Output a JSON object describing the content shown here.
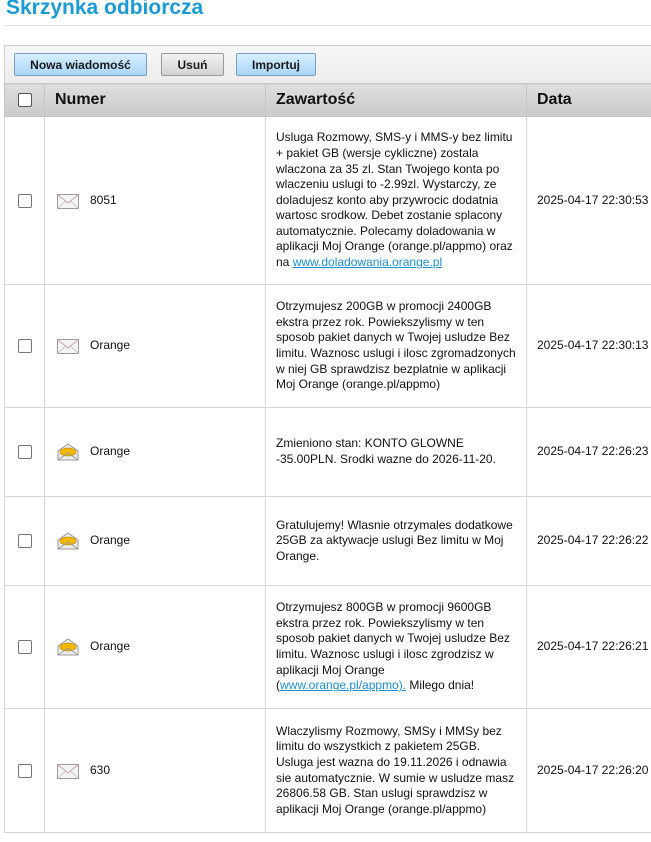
{
  "page": {
    "title": "Skrzynka odbiorcza"
  },
  "toolbar": {
    "new_label": "Nowa wiadomość",
    "delete_label": "Usuń",
    "import_label": "Importuj"
  },
  "table": {
    "headers": {
      "number": "Numer",
      "content": "Zawartość",
      "date": "Data"
    },
    "rows": [
      {
        "icon": "envelope-closed-icon",
        "number": "8051",
        "content": "Usluga Rozmowy, SMS-y i MMS-y bez limitu + pakiet GB (wersje cykliczne) zostala wlaczona za 35 zl. Stan Twojego konta po wlaczeniu uslugi to -2.99zl. Wystarczy, ze doladujesz konto aby przywrocic dodatnia wartosc srodkow. Debet zostanie splacony automatycznie. Polecamy doladowania w aplikacji Moj Orange (orange.pl/appmo) oraz na ",
        "link": "www.doladowania.orange.pl",
        "suffix": "",
        "date": "2025-04-17 22:30:53"
      },
      {
        "icon": "envelope-closed-icon",
        "number": "Orange",
        "content": "Otrzymujesz 200GB w promocji 2400GB ekstra przez rok. Powiekszylismy w ten sposob pakiet danych w Twojej usludze Bez limitu. Waznosc uslugi i ilosc zgromadzonych w niej GB sprawdzisz bezplatnie w aplikacji Moj Orange (orange.pl/appmo)",
        "link": "",
        "suffix": "",
        "date": "2025-04-17 22:30:13"
      },
      {
        "icon": "envelope-open-icon",
        "number": "Orange",
        "content": "Zmieniono stan: KONTO GLOWNE -35.00PLN. Srodki wazne do 2026-11-20.",
        "link": "",
        "suffix": "",
        "date": "2025-04-17 22:26:23"
      },
      {
        "icon": "envelope-open-icon",
        "number": "Orange",
        "content": "Gratulujemy! Wlasnie otrzymales dodatkowe 25GB za aktywacje uslugi Bez limitu w Moj Orange.",
        "link": "",
        "suffix": "",
        "date": "2025-04-17 22:26:22"
      },
      {
        "icon": "envelope-open-icon",
        "number": "Orange",
        "content": "Otrzymujesz 800GB w promocji 9600GB ekstra przez rok. Powiekszylismy w ten sposob pakiet danych w Twojej usludze Bez limitu. Waznosc uslugi i ilosc zgrodzisz w aplikacji Moj Orange (",
        "link": "www.orange.pl/appmo).",
        "suffix": " Milego dnia!",
        "date": "2025-04-17 22:26:21"
      },
      {
        "icon": "envelope-closed-icon",
        "number": "630",
        "content": "Wlaczylismy Rozmowy, SMSy i MMSy bez limitu do wszystkich z pakietem 25GB. Usluga jest wazna do 19.11.2026 i odnawia sie automatycznie. W sumie w usludze masz 26806.58 GB. Stan uslugi sprawdzisz w aplikacji Moj Orange (orange.pl/appmo)",
        "link": "",
        "suffix": "",
        "date": "2025-04-17 22:26:20"
      }
    ]
  },
  "colors": {
    "title": "#1a9ad6",
    "link": "#1a8fd6",
    "open_envelope_accent": "#f5b800"
  }
}
